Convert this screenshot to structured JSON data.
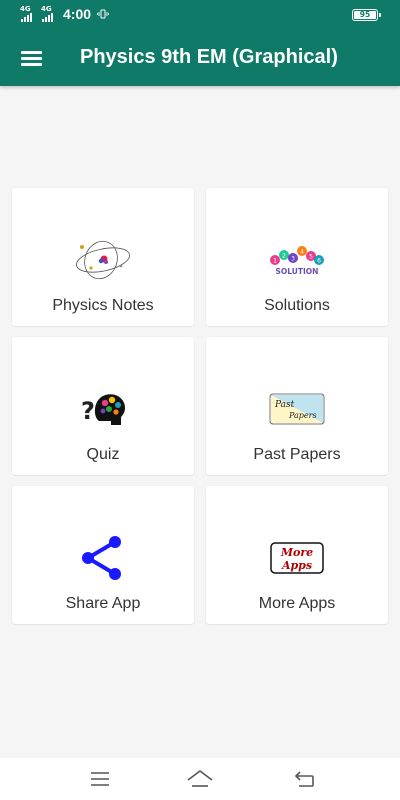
{
  "status_bar": {
    "network_1": "4G",
    "network_2": "4G",
    "time": "4:00",
    "battery_level": "95"
  },
  "app_bar": {
    "title": "Physics 9th EM (Graphical)",
    "menu_icon": "hamburger-menu-icon"
  },
  "menu": [
    {
      "label": "Physics Notes",
      "icon": "atom-icon"
    },
    {
      "label": "Solutions",
      "icon": "solution-balloons-icon"
    },
    {
      "label": "Quiz",
      "icon": "question-brain-gears-icon"
    },
    {
      "label": "Past Papers",
      "icon": "past-papers-icon",
      "icon_text_1": "Past",
      "icon_text_2": "Papers"
    },
    {
      "label": "Share App",
      "icon": "share-icon",
      "color": "#1a1aff"
    },
    {
      "label": "More Apps",
      "icon": "more-apps-icon",
      "icon_text_1": "More",
      "icon_text_2": "Apps",
      "color": "#b00000"
    }
  ],
  "solution_icon_text": "SOLUTION",
  "solution_balloon_letters": [
    "1",
    "2",
    "3",
    "4",
    "5",
    "6"
  ],
  "quiz_icon_symbol": "?",
  "nav_bar": {
    "recents_icon": "menu-lines-icon",
    "home_icon": "home-icon",
    "back_icon": "back-icon"
  },
  "colors": {
    "primary": "#0f7a68",
    "background": "#f5f5f5",
    "card": "#ffffff",
    "label_text": "#333333"
  }
}
